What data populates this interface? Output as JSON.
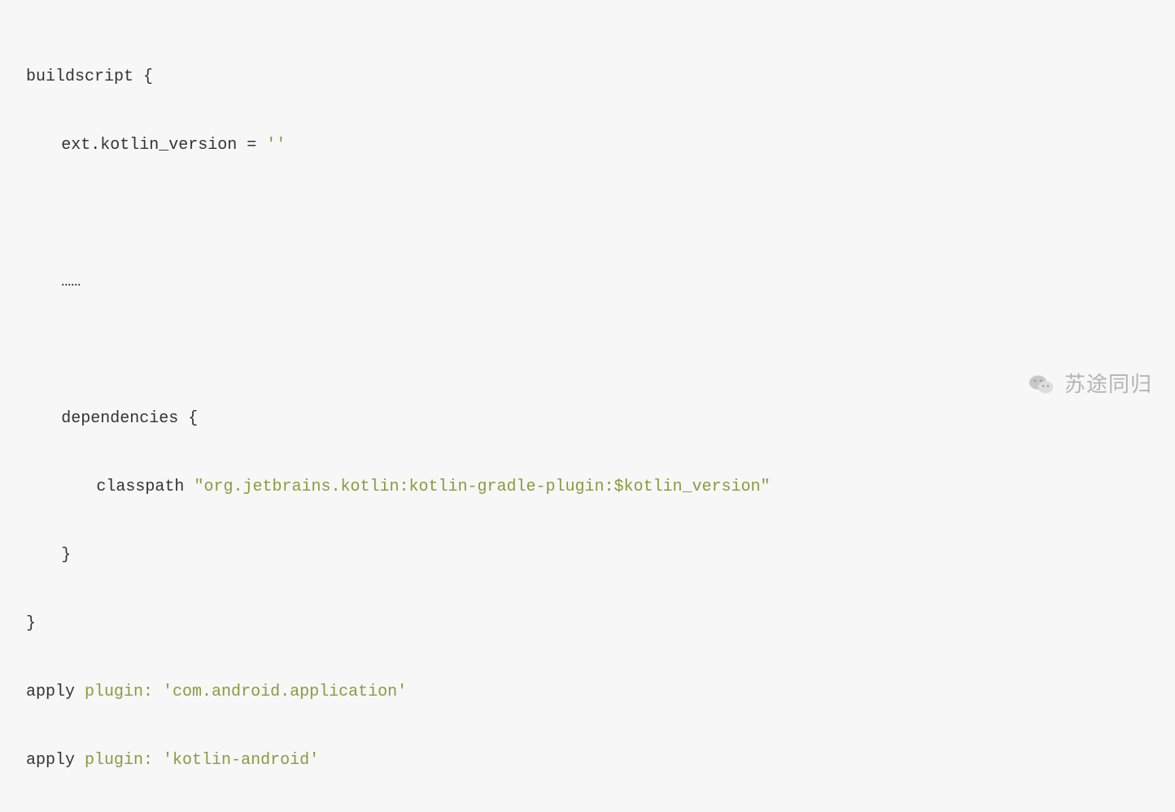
{
  "code": {
    "line1_buildscript": "buildscript {",
    "line2_ext": "ext.kotlin_version = ",
    "line2_string": "''",
    "line4_ellipsis": "……",
    "line6_deps": "dependencies {",
    "line7_classpath": "classpath ",
    "line7_string": "\"org.jetbrains.kotlin:kotlin-gradle-plugin:$kotlin_version\"",
    "line8_close": "}",
    "line9_close": "}",
    "line10_apply": "apply ",
    "line10_attr": "plugin:",
    "line10_space": " ",
    "line10_string": "'com.android.application'",
    "line11_apply": "apply ",
    "line11_attr": "plugin:",
    "line11_space": " ",
    "line11_string": "'kotlin-android'"
  },
  "watermark": {
    "text": "苏途同归"
  }
}
